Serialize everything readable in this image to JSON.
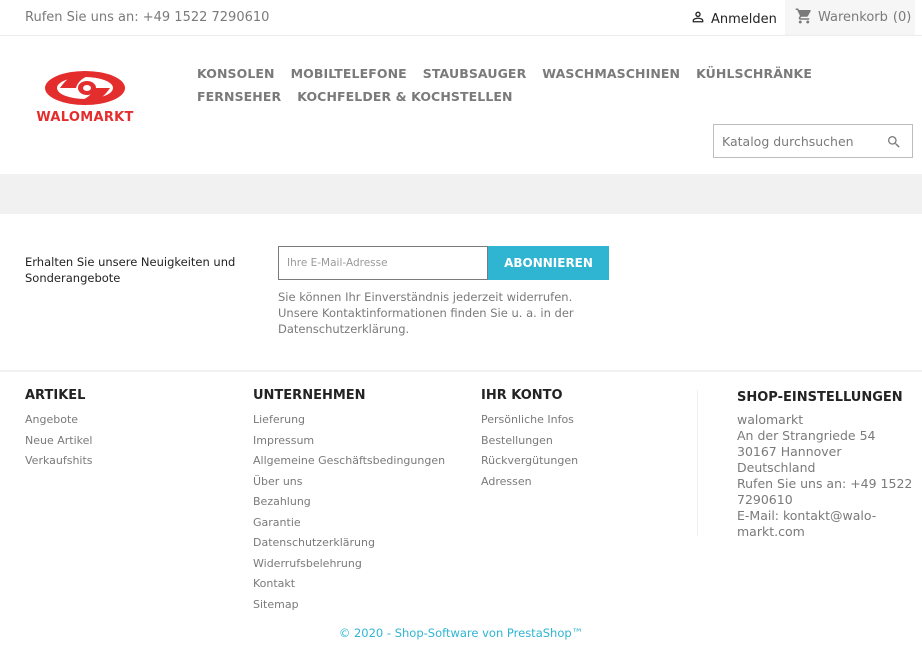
{
  "topbar": {
    "contact": "Rufen Sie uns an: +49 1522 7290610",
    "login_label": "Anmelden",
    "cart_label": "Warenkorb",
    "cart_count": "(0)"
  },
  "header": {
    "logo_text": "WALOMARKT",
    "menu": [
      "KONSOLEN",
      "MOBILTELEFONE",
      "STAUBSAUGER",
      "WASCHMASCHINEN",
      "KÜHLSCHRÄNKE",
      "FERNSEHER",
      "KOCHFELDER & KOCHSTELLEN"
    ],
    "search_placeholder": "Katalog durchsuchen"
  },
  "newsletter": {
    "label": "Erhalten Sie unsere Neuigkeiten und Sonderangebote",
    "email_placeholder": "Ihre E-Mail-Adresse",
    "button": "ABONNIEREN",
    "note": "Sie können Ihr Einverständnis jederzeit widerrufen. Unsere Kontaktinformationen finden Sie u. a. in der Datenschutzerklärung."
  },
  "footer": {
    "artikel": {
      "title": "ARTIKEL",
      "links": [
        "Angebote",
        "Neue Artikel",
        "Verkaufshits"
      ]
    },
    "unternehmen": {
      "title": "UNTERNEHMEN",
      "links": [
        "Lieferung",
        "Impressum",
        "Allgemeine Geschäftsbedingungen",
        "Über uns",
        "Bezahlung",
        "Garantie",
        "Datenschutzerklärung",
        "Widerrufsbelehrung",
        "Kontakt",
        "Sitemap"
      ]
    },
    "konto": {
      "title": "IHR KONTO",
      "links": [
        "Persönliche Infos",
        "Bestellungen",
        "Rückvergütungen",
        "Adressen"
      ]
    },
    "shop": {
      "title": "SHOP-EINSTELLUNGEN",
      "lines": [
        "walomarkt",
        "An der Strangriede 54",
        "30167 Hannover",
        "Deutschland",
        "Rufen Sie uns an: +49 1522 7290610",
        "E-Mail: kontakt@walo-markt.com"
      ]
    },
    "copyright": "© 2020 - Shop-Software von PrestaShop™"
  },
  "colors": {
    "accent": "#2fb5d2",
    "brand_red": "#e42d2d",
    "text_gray": "#7a7a7a",
    "text_dark": "#232323"
  },
  "icons": {
    "login": "user-icon",
    "cart": "shopping-cart-icon",
    "search": "search-icon",
    "logo": "walomarkt-logo"
  }
}
